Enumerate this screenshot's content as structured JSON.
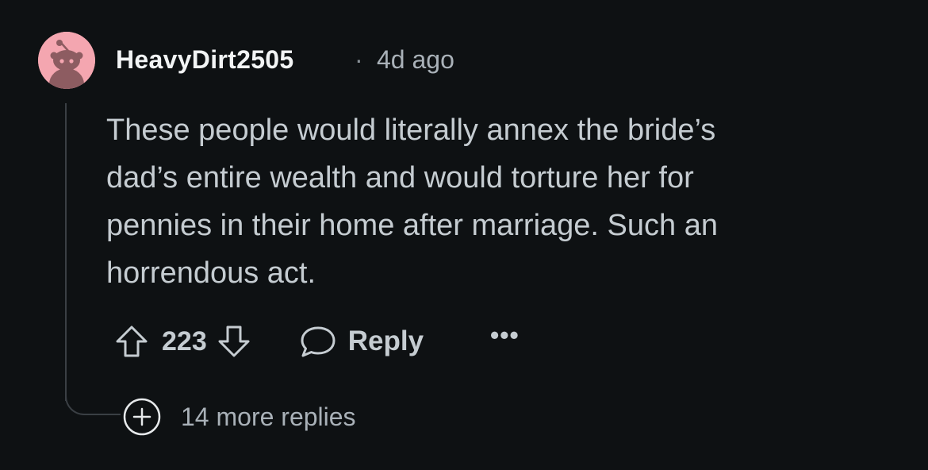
{
  "comment": {
    "username": "HeavyDirt2505",
    "separator": "·",
    "timestamp": "4d ago",
    "body_lines": [
      "These people would literally annex the bride’s",
      "dad’s entire wealth and would torture her for",
      "pennies in their home after marriage. Such an",
      "horrendous act."
    ],
    "avatar": {
      "icon": "snoo-avatar-icon",
      "bg_color": "#f4a6b0"
    }
  },
  "actions": {
    "upvote_icon": "upvote-arrow-icon",
    "vote_count": "223",
    "downvote_icon": "downvote-arrow-icon",
    "reply_icon": "chat-bubble-icon",
    "reply_label": "Reply",
    "more_label": "•••"
  },
  "replies": {
    "icon": "plus-circle-icon",
    "label": "14 more replies"
  },
  "colors": {
    "background": "#0e1113",
    "text": "#c5ccd1",
    "muted": "#a9b1b8",
    "thread_line": "#3a3f44"
  }
}
